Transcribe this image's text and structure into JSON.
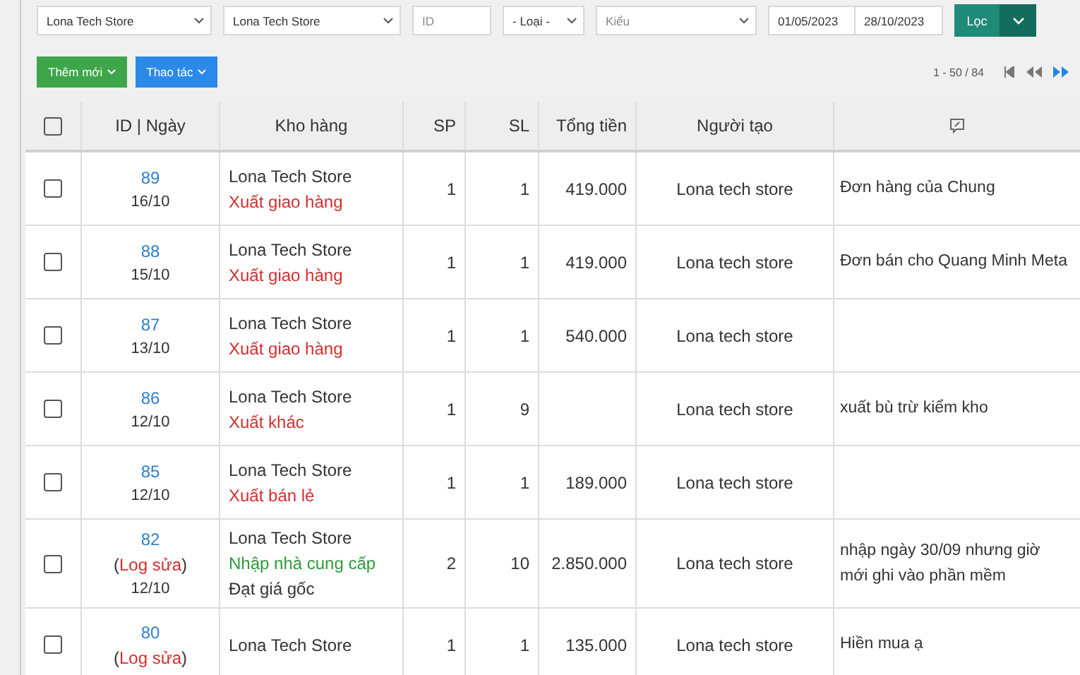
{
  "filters": {
    "store_1": "Lona Tech Store",
    "store_2": "Lona Tech Store",
    "id_placeholder": "ID",
    "type": "- Loại -",
    "kind_placeholder": "Kiểu",
    "date_from": "01/05/2023",
    "date_to": "28/10/2023",
    "filter_button": "Lọc"
  },
  "actions": {
    "add_button": "Thêm mới",
    "ops_button": "Thao tác",
    "pagination": "1 - 50 / 84"
  },
  "table": {
    "select_all_checked": false,
    "columns": [
      "ID | Ngày",
      "Kho hàng",
      "SP",
      "SL",
      "Tổng tiền",
      "Người tạo"
    ],
    "rows": [
      {
        "id": "89",
        "date": "16/10",
        "store": "Lona Tech Store",
        "type": "Xuất giao hàng",
        "kind": "export",
        "sp": "1",
        "sl": "1",
        "total": "419.000",
        "creator": "Lona tech store",
        "note": "Đơn hàng của Chung",
        "checked": false
      },
      {
        "id": "88",
        "date": "15/10",
        "store": "Lona Tech Store",
        "type": "Xuất giao hàng",
        "kind": "export",
        "sp": "1",
        "sl": "1",
        "total": "419.000",
        "creator": "Lona tech store",
        "note": "Đơn bán cho Quang Minh Meta",
        "checked": false
      },
      {
        "id": "87",
        "date": "13/10",
        "store": "Lona Tech Store",
        "type": "Xuất giao hàng",
        "kind": "export",
        "sp": "1",
        "sl": "1",
        "total": "540.000",
        "creator": "Lona tech store",
        "checked": false
      },
      {
        "id": "86",
        "date": "12/10",
        "store": "Lona Tech Store",
        "type": "Xuất khác",
        "kind": "export",
        "sp": "1",
        "sl": "9",
        "creator": "Lona tech store",
        "note": "xuất bù trừ kiểm kho",
        "checked": false
      },
      {
        "id": "85",
        "date": "12/10",
        "store": "Lona Tech Store",
        "type": "Xuất bán lẻ",
        "kind": "export",
        "sp": "1",
        "sl": "1",
        "total": "189.000",
        "creator": "Lona tech store",
        "checked": false
      },
      {
        "id": "82",
        "log_open": "(",
        "log": "Log sửa",
        "log_close": ")",
        "date": "12/10",
        "store": "Lona Tech Store",
        "type": "Nhập nhà cung cấp",
        "kind": "import",
        "extra": "Đạt giá gốc",
        "sp": "2",
        "sl": "10",
        "total": "2.850.000",
        "creator": "Lona tech store",
        "note": "nhập ngày 30/09 nhưng giờ mới ghi vào phần mềm",
        "checked": false
      },
      {
        "id": "80",
        "log_open": "(",
        "log": "Log sửa",
        "log_close": ")",
        "store": "Lona Tech Store",
        "sp": "1",
        "sl": "1",
        "total": "135.000",
        "creator": "Lona tech store",
        "note": "Hiền mua ạ",
        "checked": false
      }
    ]
  }
}
